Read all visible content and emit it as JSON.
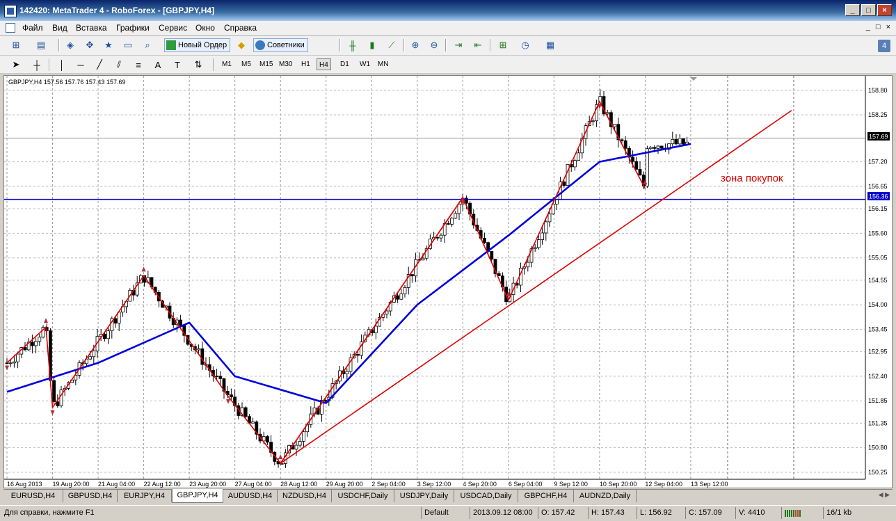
{
  "window": {
    "title": "142420: MetaTrader 4 - RoboForex - [GBPJPY,H4]",
    "buttons": [
      "_",
      "□",
      "×"
    ]
  },
  "menu": {
    "items": [
      "Файл",
      "Вид",
      "Вставка",
      "Графики",
      "Сервис",
      "Окно",
      "Справка"
    ],
    "mdi_buttons": [
      "_",
      "□",
      "×"
    ]
  },
  "toolbar": {
    "new_order_label": "Новый Ордер",
    "experts_label": "Советники",
    "badge": "4"
  },
  "timeframes": {
    "items": [
      "M1",
      "M5",
      "M15",
      "M30",
      "H1",
      "H4",
      "D1",
      "W1",
      "MN"
    ],
    "active": "H4"
  },
  "chart": {
    "header": "GBPJPY,H4  157.56  157.76  157.43  157.69",
    "current_price_label": "157.69",
    "hline_label": "156.36",
    "annotation": "зона покупок",
    "colors": {
      "ma": "#0000dd",
      "zigzag": "#dd0000",
      "hline": "#0000cc",
      "bull": "#ffffff",
      "bear": "#000000",
      "fractal": "#b0303a"
    }
  },
  "chart_data": {
    "type": "candlestick",
    "symbol": "GBPJPY",
    "timeframe": "H4",
    "ohlc": {
      "open": 157.56,
      "high": 157.76,
      "low": 157.43,
      "close": 157.69
    },
    "ylim": [
      150.25,
      159.0
    ],
    "y_ticks": [
      "158.80",
      "158.25",
      "157.73",
      "157.20",
      "156.65",
      "156.15",
      "155.60",
      "155.05",
      "154.55",
      "154.00",
      "153.45",
      "152.95",
      "152.40",
      "151.85",
      "151.35",
      "150.80",
      "150.25"
    ],
    "x_ticks": [
      "16 Aug 2013",
      "19 Aug 20:00",
      "21 Aug 04:00",
      "22 Aug 12:00",
      "23 Aug 20:00",
      "27 Aug 04:00",
      "28 Aug 12:00",
      "29 Aug 20:00",
      "2 Sep 04:00",
      "3 Sep 12:00",
      "4 Sep 20:00",
      "6 Sep 04:00",
      "9 Sep 12:00",
      "10 Sep 20:00",
      "12 Sep 04:00",
      "13 Sep 12:00"
    ],
    "zigzag": [
      {
        "x": "16 Aug 2013",
        "y": 152.7
      },
      {
        "x": "19 Aug 04:00",
        "y": 153.5
      },
      {
        "x": "19 Aug 20:00",
        "y": 151.7
      },
      {
        "x": "22 Aug 12:00",
        "y": 154.65
      },
      {
        "x": "26 Aug 20:00",
        "y": 151.95
      },
      {
        "x": "28 Aug 12:00",
        "y": 150.45
      },
      {
        "x": "4 Sep 20:00",
        "y": 156.4
      },
      {
        "x": "6 Sep 04:00",
        "y": 154.1
      },
      {
        "x": "10 Sep 20:00",
        "y": 158.55
      },
      {
        "x": "12 Sep 04:00",
        "y": 156.6
      }
    ],
    "ma_line": [
      {
        "x": "16 Aug 2013",
        "y": 152.05
      },
      {
        "x": "21 Aug 04:00",
        "y": 152.7
      },
      {
        "x": "23 Aug 20:00",
        "y": 153.6
      },
      {
        "x": "27 Aug 04:00",
        "y": 152.4
      },
      {
        "x": "29 Aug 20:00",
        "y": 151.8
      },
      {
        "x": "3 Sep 12:00",
        "y": 154.0
      },
      {
        "x": "6 Sep 04:00",
        "y": 155.55
      },
      {
        "x": "10 Sep 20:00",
        "y": 157.2
      },
      {
        "x": "13 Sep 12:00",
        "y": 157.6
      }
    ],
    "trendline": [
      {
        "x": "28 Aug 12:00",
        "y": 150.45
      },
      {
        "x": "6 Sep 04:00",
        "y": 154.1
      },
      {
        "y": 158.35
      }
    ],
    "horizontal_levels": [
      157.73,
      156.36
    ],
    "annotations": [
      "зона покупок"
    ]
  },
  "tabs": {
    "items": [
      "EURUSD,H4",
      "GBPUSD,H4",
      "EURJPY,H4",
      "GBPJPY,H4",
      "AUDUSD,H4",
      "NZDUSD,H4",
      "USDCHF,Daily",
      "USDJPY,Daily",
      "USDCAD,Daily",
      "GBPCHF,H4",
      "AUDNZD,Daily"
    ],
    "active": "GBPJPY,H4"
  },
  "status": {
    "help": "Для справки, нажмите F1",
    "default": "Default",
    "datetime": "2013.09.12 08:00",
    "open": "O: 157.42",
    "high": "H: 157.43",
    "low": "L: 156.92",
    "close": "C: 157.09",
    "volume": "V: 4410",
    "traffic": "16/1 kb"
  }
}
